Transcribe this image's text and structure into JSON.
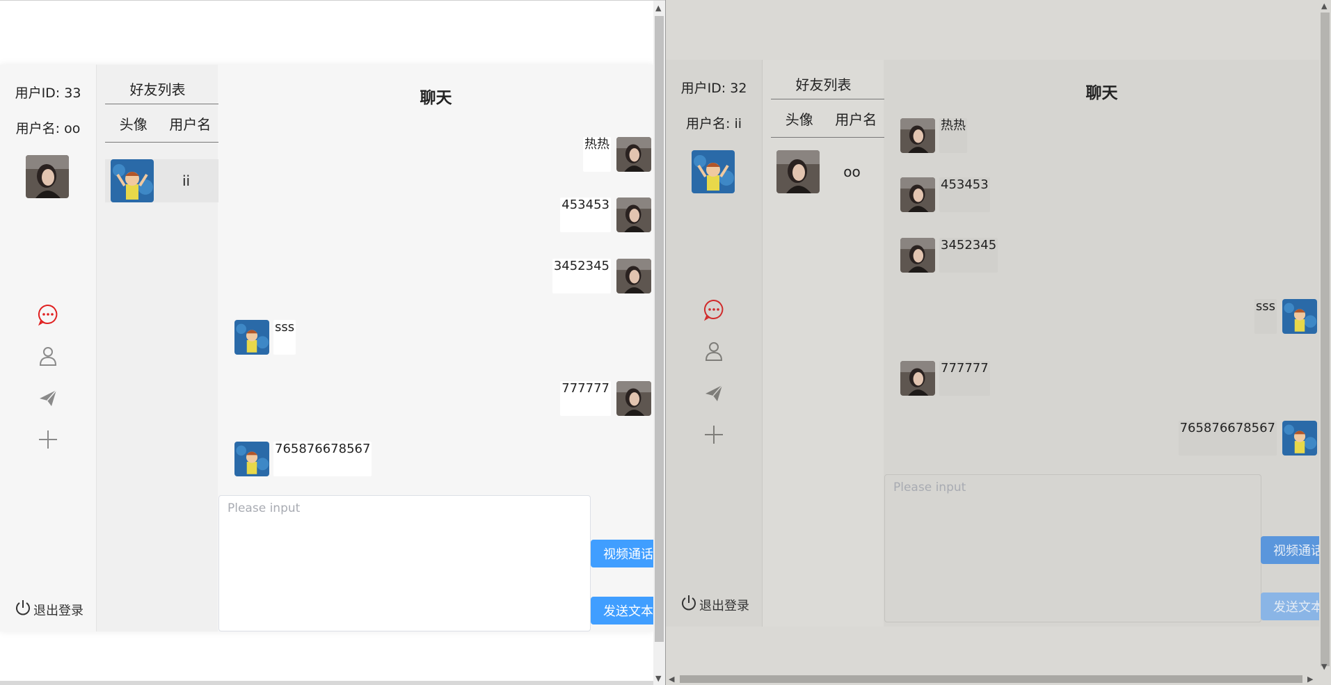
{
  "left_window": {
    "user": {
      "id_label": "用户ID: 33",
      "name_label": "用户名: oo"
    },
    "friends": {
      "title": "好友列表",
      "col_avatar": "头像",
      "col_name": "用户名",
      "items": [
        {
          "name": "ii"
        }
      ]
    },
    "chat": {
      "title": "聊天",
      "messages": [
        {
          "text": "热热",
          "side": "right"
        },
        {
          "text": "453453",
          "side": "right"
        },
        {
          "text": "3452345",
          "side": "right"
        },
        {
          "text": "sss",
          "side": "left"
        },
        {
          "text": "777777",
          "side": "right"
        },
        {
          "text": "765876678567",
          "side": "left"
        }
      ],
      "input_placeholder": "Please input",
      "video_call_label": "视频通话",
      "send_text_label": "发送文本"
    },
    "logout_label": "退出登录"
  },
  "right_window": {
    "user": {
      "id_label": "用户ID: 32",
      "name_label": "用户名: ii"
    },
    "friends": {
      "title": "好友列表",
      "col_avatar": "头像",
      "col_name": "用户名",
      "items": [
        {
          "name": "oo"
        }
      ]
    },
    "chat": {
      "title": "聊天",
      "messages": [
        {
          "text": "热热",
          "side": "left"
        },
        {
          "text": "453453",
          "side": "left"
        },
        {
          "text": "3452345",
          "side": "left"
        },
        {
          "text": "sss",
          "side": "right"
        },
        {
          "text": "777777",
          "side": "left"
        },
        {
          "text": "765876678567",
          "side": "right"
        }
      ],
      "input_placeholder": "Please input",
      "video_call_label": "视频通话",
      "send_text_label": "发送文本"
    },
    "logout_label": "退出登录"
  },
  "icons": {
    "chat_nav": "chat-bubble-icon",
    "contacts_nav": "user-icon",
    "send_nav": "paper-plane-icon",
    "add_nav": "plus-icon",
    "logout": "power-icon"
  },
  "colors": {
    "primary": "#409eff",
    "active_nav": "#e02020",
    "nav_inactive": "#8a8a8a"
  }
}
